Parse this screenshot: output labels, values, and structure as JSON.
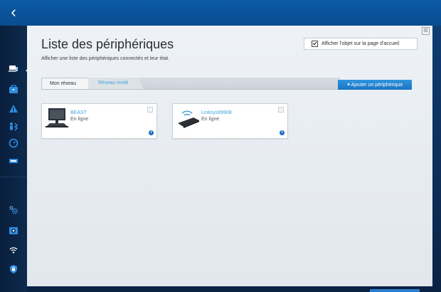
{
  "nav": {
    "back_icon": "chevron-left-icon",
    "back_glyph": "‹"
  },
  "sidebar": {
    "items": [
      {
        "name": "device-list-icon",
        "active": true
      },
      {
        "name": "toolbox-icon",
        "active": false
      },
      {
        "name": "warning-icon",
        "active": false
      },
      {
        "name": "parental-controls-icon",
        "active": false
      },
      {
        "name": "speed-test-icon",
        "active": false
      },
      {
        "name": "usb-icon",
        "active": false
      },
      {
        "name": "settings-gears-icon",
        "active": false
      },
      {
        "name": "camera-icon",
        "active": false
      },
      {
        "name": "wifi-icon",
        "active": false
      },
      {
        "name": "security-shield-icon",
        "active": false
      }
    ]
  },
  "panel": {
    "title": "Liste des périphériques",
    "subtitle": "Afficher une liste des périphériques connectés et leur état.",
    "close_glyph": "⊠",
    "show_on_home_label": "Afficher l'objet sur la page d'accueil",
    "show_on_home_checked": true
  },
  "tabs": [
    {
      "label": "Mon réseau",
      "active": true
    },
    {
      "label": "Réseau invité",
      "active": false
    }
  ],
  "add_device": {
    "plus": "+",
    "label": "Ajouter un périphérique"
  },
  "devices": [
    {
      "name": "BEAST",
      "status": "En ligne",
      "icon": "desktop-computer-icon"
    },
    {
      "name": "Linksys69908",
      "status": "En ligne",
      "icon": "wireless-router-icon"
    }
  ],
  "info_glyph": "i",
  "colors": {
    "accent": "#3fa4d8",
    "top_bar": "#0b5aa6",
    "button": "#1a74c2",
    "rail": "#0a1f3d"
  }
}
